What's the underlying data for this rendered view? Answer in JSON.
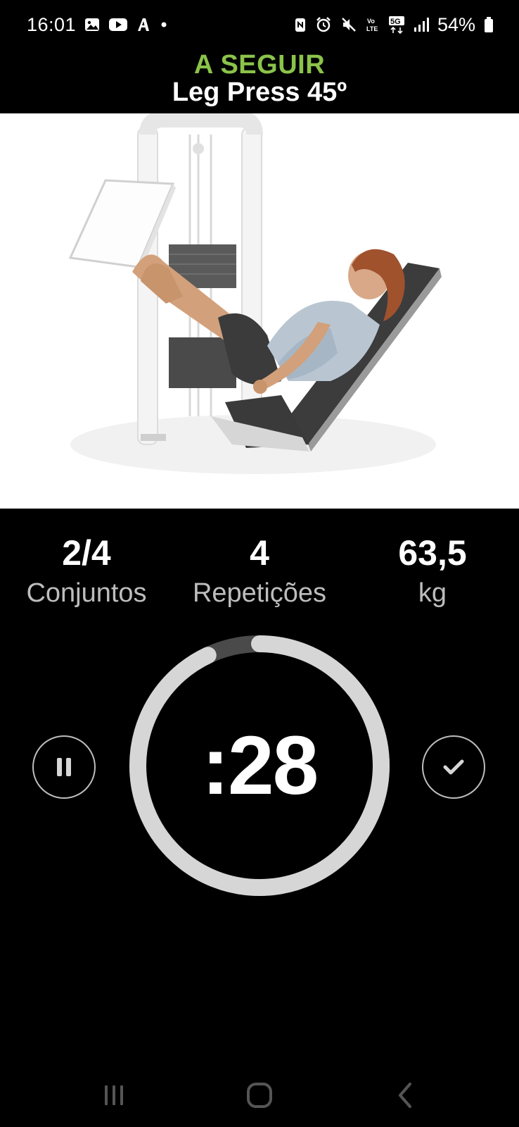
{
  "status_bar": {
    "time": "16:01",
    "battery": "54%",
    "network": "5G",
    "volte": "Vo LTE",
    "notification_icons": [
      "gallery-icon",
      "youtube-icon",
      "app-a-icon",
      "dot-icon"
    ],
    "system_icons": [
      "nfc-icon",
      "alarm-icon",
      "mute-icon",
      "volte-icon",
      "5g-icon",
      "signal-icon",
      "battery-icon"
    ]
  },
  "header": {
    "kicker": "A SEGUIR",
    "title": "Leg Press 45º"
  },
  "stats": [
    {
      "value": "2/4",
      "label": "Conjuntos"
    },
    {
      "value": "4",
      "label": "Repetições"
    },
    {
      "value": "63,5",
      "label": "kg"
    }
  ],
  "timer": {
    "display": ":28",
    "progress_fraction": 0.93
  },
  "controls": {
    "pause_icon": "pause-icon",
    "done_icon": "check-icon"
  },
  "nav": {
    "icons": [
      "recent-apps-icon",
      "home-icon",
      "back-icon"
    ]
  },
  "colors": {
    "accent": "#8bc34a",
    "background": "#000000",
    "ring": "#d6d6d6",
    "ring_track": "#4a4a4a",
    "label": "#bdbdbd"
  }
}
